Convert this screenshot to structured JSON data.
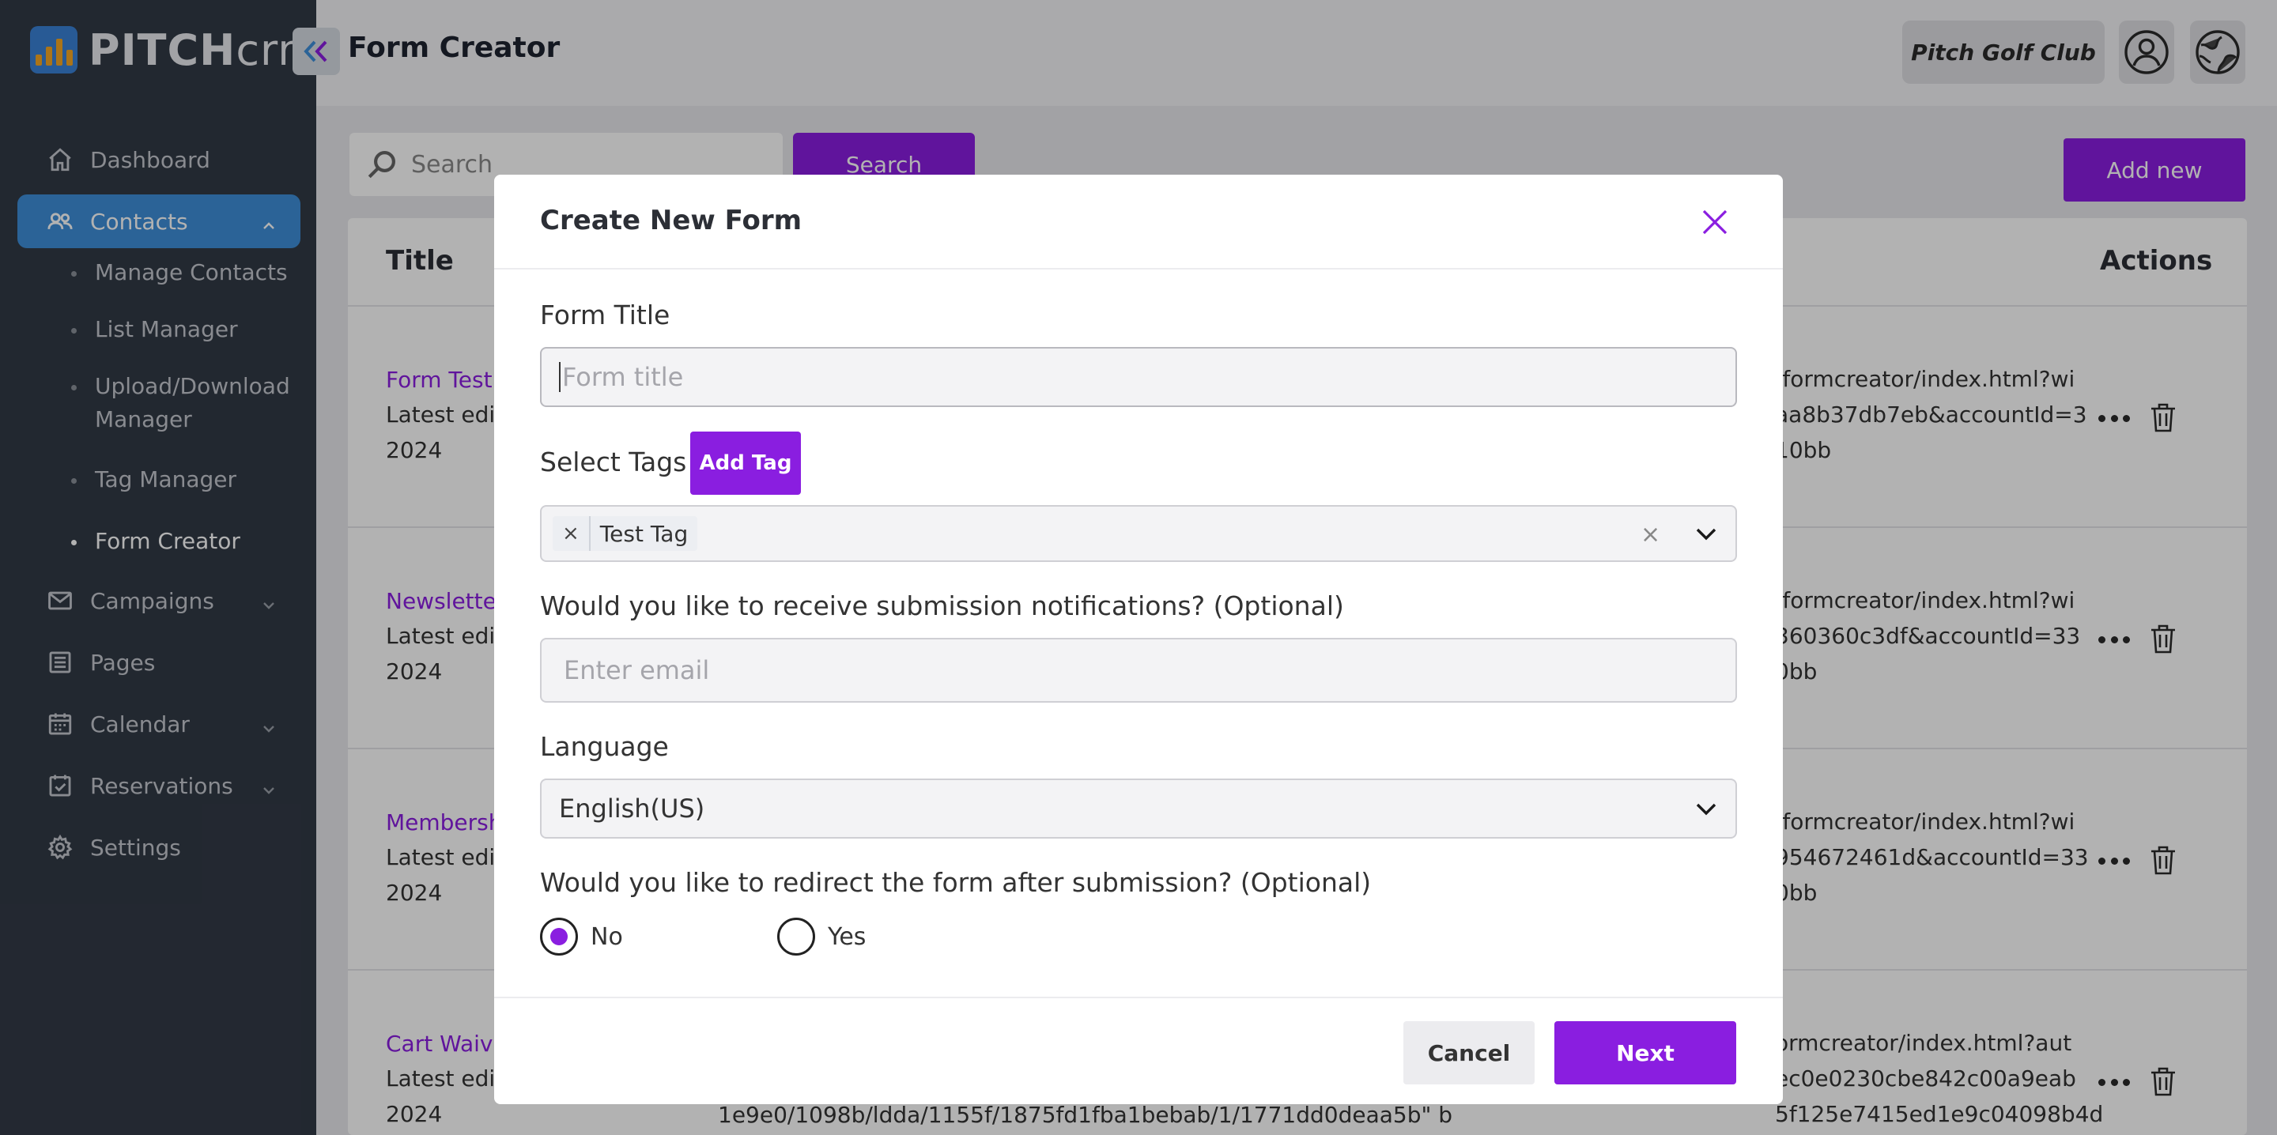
{
  "app": {
    "logo_bold": "PITCH",
    "logo_thin": "crm",
    "page_title": "Form Creator",
    "club_name": "Pitch Golf Club"
  },
  "sidebar": {
    "items": [
      {
        "label": "Dashboard",
        "icon": "home-icon"
      },
      {
        "label": "Contacts",
        "icon": "users-icon",
        "active": true
      },
      {
        "label": "Campaigns",
        "icon": "mail-icon"
      },
      {
        "label": "Pages",
        "icon": "pages-icon"
      },
      {
        "label": "Calendar",
        "icon": "calendar-icon"
      },
      {
        "label": "Reservations",
        "icon": "checkbox-icon"
      },
      {
        "label": "Settings",
        "icon": "gear-icon"
      }
    ],
    "contacts_sub": [
      {
        "label": "Manage Contacts"
      },
      {
        "label": "List Manager"
      },
      {
        "label": "Upload/Download Manager"
      },
      {
        "label": "Tag Manager"
      },
      {
        "label": "Form Creator",
        "current": true
      }
    ]
  },
  "toolbar": {
    "search_placeholder": "Search",
    "search_button": "Search",
    "add_new": "Add new"
  },
  "table": {
    "headers": {
      "title": "Title",
      "actions": "Actions"
    },
    "rows": [
      {
        "title": "Form Test",
        "sub1": "Latest edit",
        "sub2": "2024",
        "url1": "/formcreator/index.html?wi",
        "url2": "aa8b37db7eb&accountId=3",
        "url3": "10bb"
      },
      {
        "title": "Newsletter",
        "sub1": "Latest edit",
        "sub2": "2024",
        "url1": "/formcreator/index.html?wi",
        "url2": "360360c3df&accountId=33",
        "url3": "0bb"
      },
      {
        "title": "Membersh",
        "sub1": "Latest edit",
        "sub2": "2024",
        "url1": "/formcreator/index.html?wi",
        "url2": "954672461d&accountId=33",
        "url3": "0bb"
      },
      {
        "title": "Cart Waive",
        "sub1": "Latest edit",
        "sub2": "2024",
        "url1": "ormcreator/index.html?aut",
        "url2": "ec0e0230cbe842c00a9eab",
        "url3": "5f125e7415ed1e9c04098b4d",
        "mid": "1e9e0/1098b/ldda/1155f/1875fd1fba1bebab/1/1771dd0deaa5b\" b"
      }
    ]
  },
  "modal": {
    "title": "Create New Form",
    "form_title_label": "Form Title",
    "form_title_placeholder": "Form title",
    "tags_label": "Select Tags",
    "add_tag": "Add Tag",
    "selected_tag": "Test Tag",
    "tag_remove": "×",
    "tag_clear": "×",
    "notify_label": "Would you like to receive submission notifications? (Optional)",
    "email_placeholder": "Enter email",
    "language_label": "Language",
    "language_value": "English(US)",
    "redirect_label": "Would you like to redirect the form after submission? (Optional)",
    "radio_no": "No",
    "radio_yes": "Yes",
    "redirect_selected": "No",
    "cancel": "Cancel",
    "next": "Next"
  },
  "colors": {
    "accent": "#8a1ee0",
    "sidebar_bg": "#323a46",
    "sidebar_active": "#3e8fd8"
  }
}
